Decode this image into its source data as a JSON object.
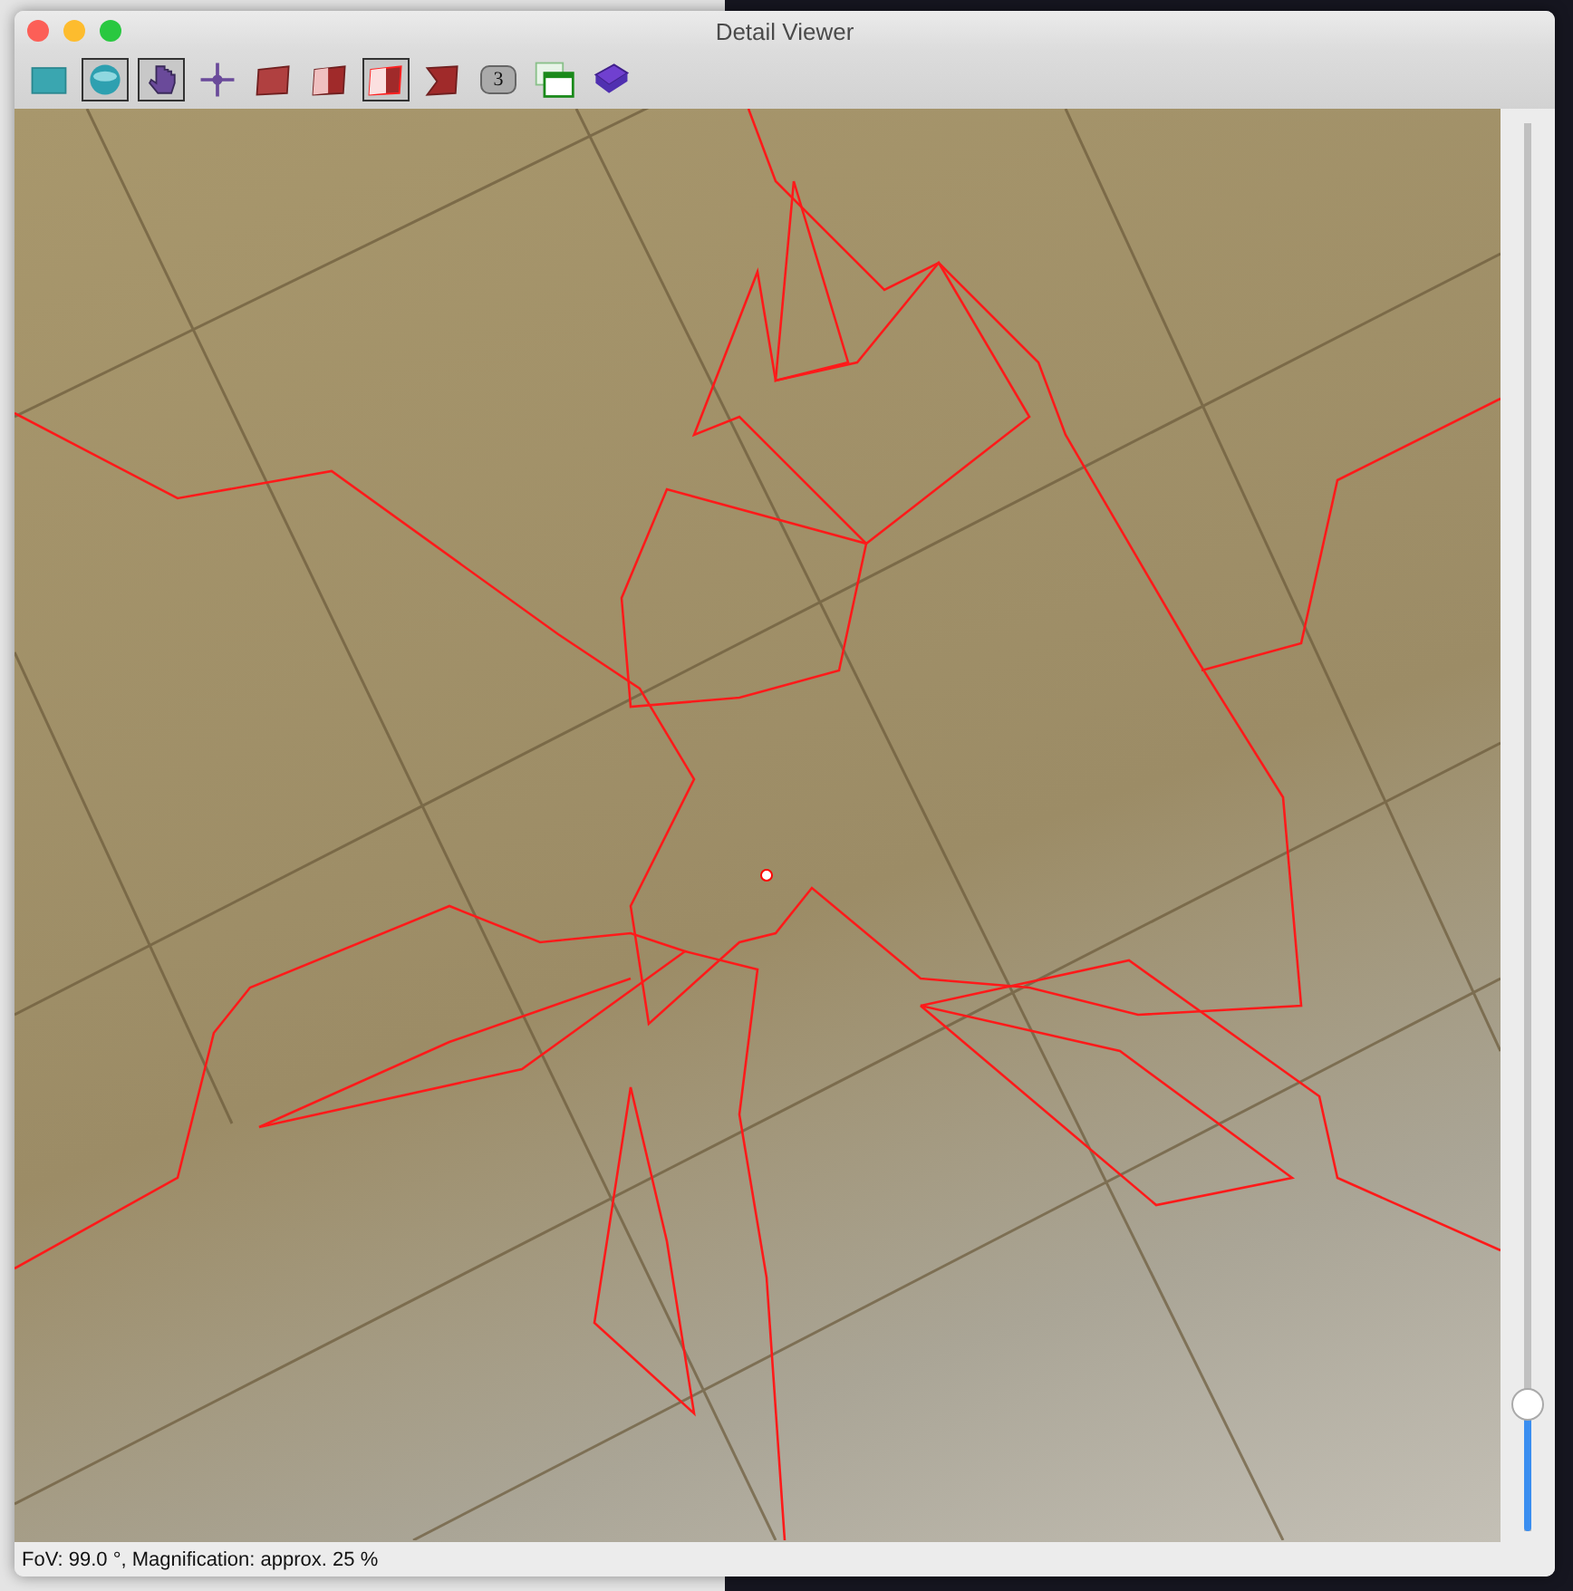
{
  "window": {
    "title": "Detail Viewer"
  },
  "toolbar": [
    {
      "kind": "rectangle",
      "selected": false
    },
    {
      "kind": "sphere",
      "selected": true
    },
    {
      "kind": "hand",
      "selected": true
    },
    {
      "kind": "move",
      "selected": false
    },
    {
      "kind": "plane1",
      "selected": false
    },
    {
      "kind": "plane2",
      "selected": false
    },
    {
      "kind": "plane3",
      "selected": true
    },
    {
      "kind": "plane4",
      "selected": false
    },
    {
      "kind": "badge",
      "label": "3",
      "selected": false
    },
    {
      "kind": "windows",
      "selected": false
    },
    {
      "kind": "book",
      "selected": false
    }
  ],
  "zoom_slider": {
    "level": 0.09
  },
  "status_bar": "FoV: 99.0 °, Magnification: approx. 25 %"
}
